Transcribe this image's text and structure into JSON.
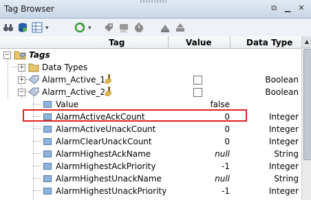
{
  "window": {
    "title": "Tag Browser"
  },
  "toolbar": {
    "icons": [
      "binoculars-icon",
      "database-refresh-icon",
      "grid-view-icon",
      "dropdown-arrow-icon",
      "refresh-icon",
      "new-tag-icon",
      "opc-icon",
      "timer-icon",
      "udt-icon",
      "import-icon"
    ]
  },
  "columns": {
    "tag": "Tag",
    "value": "Value",
    "type": "Data Type"
  },
  "rows": [
    {
      "label": "Tags",
      "value": "",
      "type": ""
    },
    {
      "label": "Data Types",
      "value": "",
      "type": ""
    },
    {
      "label": "Alarm_Active_1",
      "value": "",
      "type": "Boolean"
    },
    {
      "label": "Alarm_Active_2",
      "value": "",
      "type": "Boolean"
    },
    {
      "label": "Value",
      "value": "false",
      "type": ""
    },
    {
      "label": "AlarmActiveAckCount",
      "value": "0",
      "type": "Integer"
    },
    {
      "label": "AlarmActiveUnackCount",
      "value": "0",
      "type": "Integer"
    },
    {
      "label": "AlarmClearUnackCount",
      "value": "0",
      "type": "Integer"
    },
    {
      "label": "AlarmHighestAckName",
      "value": "null",
      "type": "String"
    },
    {
      "label": "AlarmHighestAckPriority",
      "value": "-1",
      "type": "Integer"
    },
    {
      "label": "AlarmHighestUnackName",
      "value": "null",
      "type": "String"
    },
    {
      "label": "AlarmHighestUnackPriority",
      "value": "-1",
      "type": "Integer"
    }
  ],
  "colors": {
    "highlight": "#e02020",
    "titlebar": "#c9d6e5"
  }
}
